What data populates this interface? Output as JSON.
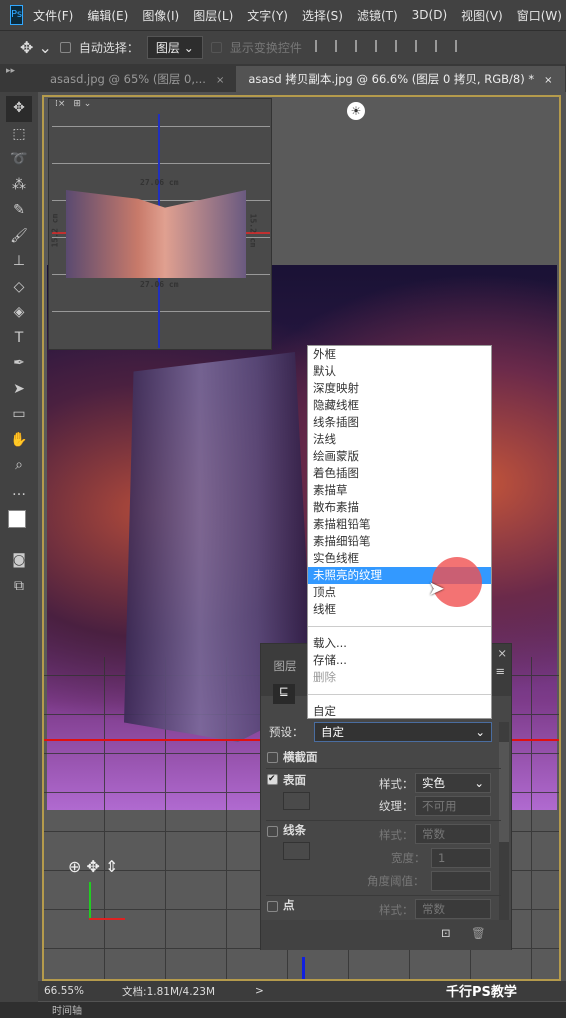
{
  "app": {
    "logo": "Ps"
  },
  "menu": [
    "文件(F)",
    "编辑(E)",
    "图像(I)",
    "图层(L)",
    "文字(Y)",
    "选择(S)",
    "滤镜(T)",
    "3D(D)",
    "视图(V)",
    "窗口(W)"
  ],
  "options": {
    "auto_select_label": "自动选择：",
    "auto_select_value": "图层",
    "show_transform_label": "显示变换控件"
  },
  "tabs": [
    {
      "label": "asasd.jpg @ 65% (图层 0,...",
      "close": "×"
    },
    {
      "label": "asasd 拷贝副本.jpg @ 66.6% (图层 0 拷贝, RGB/8) *",
      "close": "×"
    }
  ],
  "preview": {
    "width_label": "27.06 cm",
    "height_label": "15.2 cm"
  },
  "dropdown": {
    "items": [
      "外框",
      "默认",
      "深度映射",
      "隐藏线框",
      "线条插图",
      "法线",
      "绘画蒙版",
      "着色插图",
      "素描草",
      "散布素描",
      "素描粗铅笔",
      "素描细铅笔",
      "实色线框",
      "未照亮的纹理",
      "顶点",
      "线框"
    ],
    "highlighted": "未照亮的纹理",
    "actions": [
      "载入...",
      "存储...",
      "删除"
    ],
    "custom": "自定"
  },
  "properties": {
    "tab": "图层",
    "preset_label": "预设：",
    "preset_value": "自定",
    "cross_section": "横截面",
    "surface": "表面",
    "surface_checked": true,
    "style_label": "样式：",
    "surface_style": "实色",
    "texture_label": "纹理：",
    "texture_value": "不可用",
    "lines": "线条",
    "lines_style": "常数",
    "width_label": "宽度：",
    "width_value": "1",
    "angle_label": "角度阈值：",
    "points": "点",
    "points_style": "常数"
  },
  "status": {
    "zoom": "66.55%",
    "doc": "文档:1.81M/4.23M",
    "arrow": ">"
  },
  "bottom_tab": "时间轴",
  "watermark": "千行PS教学",
  "colors": {
    "highlight": "#3399ff",
    "frame": "#b59b4c"
  }
}
